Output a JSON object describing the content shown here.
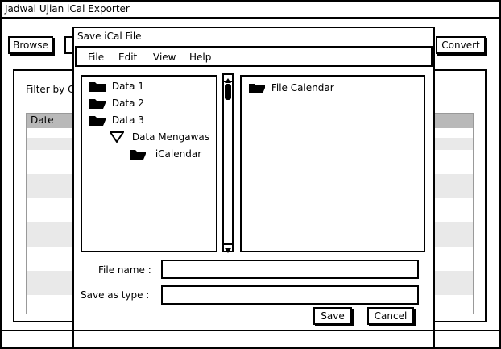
{
  "app": {
    "title": "Jadwal Ujian iCal Exporter",
    "browse_label": "Browse",
    "convert_label": "Convert",
    "filter_label": "Filter by C",
    "table": {
      "header_date": "Date"
    }
  },
  "dialog": {
    "title": "Save iCal File",
    "menu": [
      "File",
      "Edit",
      "View",
      "Help"
    ],
    "tree": [
      {
        "label": "Data 1",
        "icon": "folder-icon"
      },
      {
        "label": "Data 2",
        "icon": "folder-icon"
      },
      {
        "label": "Data 3",
        "icon": "folder-icon"
      },
      {
        "label": "Data Mengawas",
        "icon": "triangle-down-icon"
      },
      {
        "label": "iCalendar",
        "icon": "folder-icon"
      }
    ],
    "files": [
      {
        "label": "File Calendar",
        "icon": "folder-icon"
      }
    ],
    "file_name_label": "File name :",
    "file_name_value": "",
    "save_as_type_label": "Save as type :",
    "save_as_type_value": "",
    "save_label": "Save",
    "cancel_label": "Cancel"
  }
}
